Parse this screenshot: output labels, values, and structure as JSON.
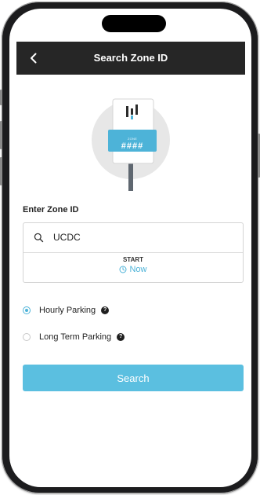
{
  "header": {
    "title": "Search Zone ID",
    "back_icon": "chevron-left-icon"
  },
  "illustration": {
    "sign_zone_label": "ZONE",
    "sign_zone_number": "####"
  },
  "form": {
    "zone_label": "Enter Zone ID",
    "zone_value": "UCDC",
    "search_icon": "search-icon",
    "start_label": "START",
    "start_value": "Now",
    "clock_icon": "clock-icon"
  },
  "parking_options": [
    {
      "label": "Hourly Parking",
      "selected": true
    },
    {
      "label": "Long Term Parking",
      "selected": false
    }
  ],
  "actions": {
    "search_label": "Search"
  },
  "colors": {
    "accent": "#4db3d8",
    "button": "#5bbfe0",
    "header_bg": "#262626"
  }
}
